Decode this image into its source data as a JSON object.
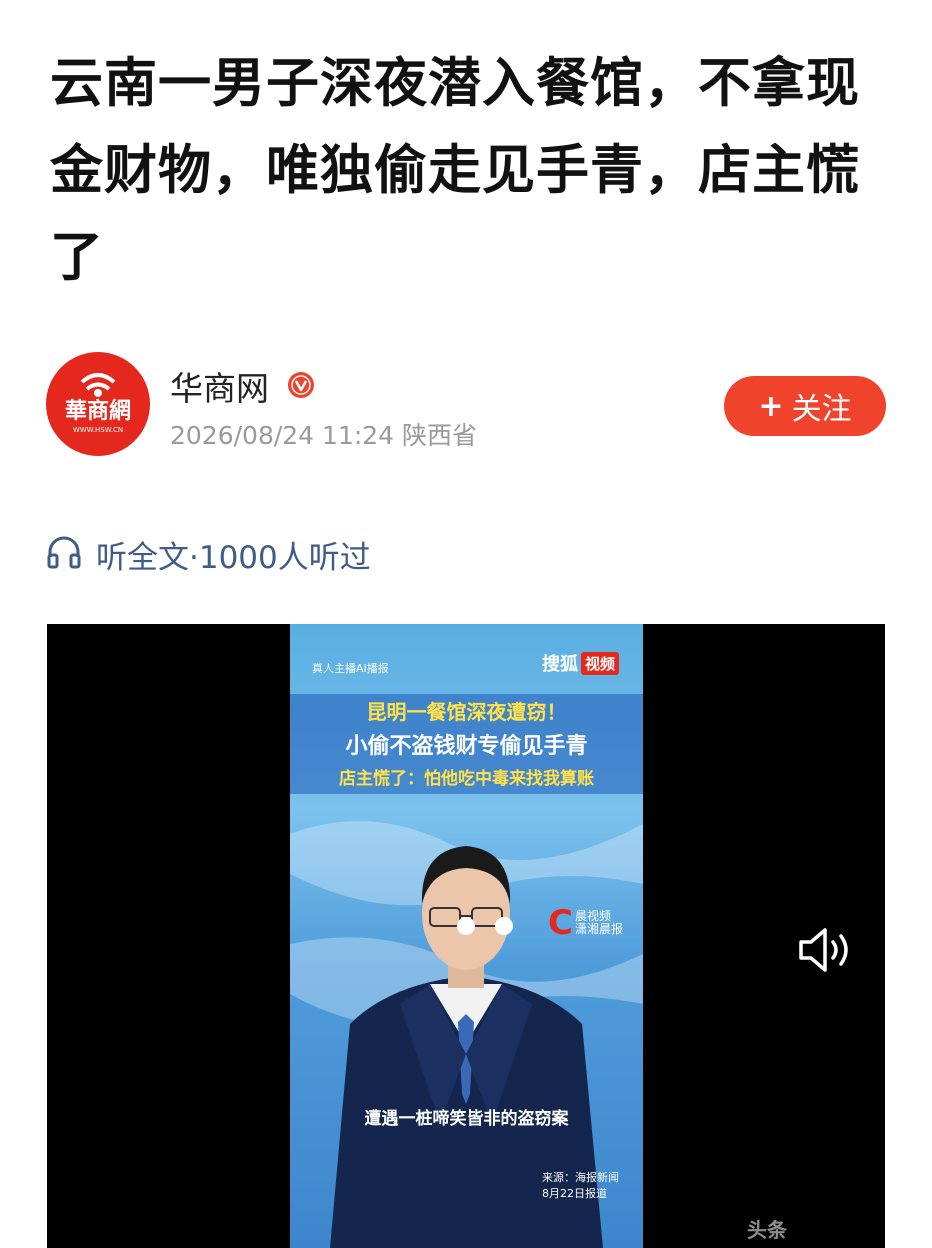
{
  "article": {
    "title": "云南一男子深夜潜入餐馆，不拿现金财物，唯独偷走见手青，店主慌了"
  },
  "author": {
    "name": "华商网",
    "avatar_text": "華商網",
    "avatar_url_text": "WWW.HSW.CN",
    "verified_icon": "verified-v-icon",
    "meta": "2026/08/24 11:24 陕西省",
    "follow_label": "关注",
    "follow_plus": "+"
  },
  "listen": {
    "icon": "headphones-icon",
    "label": "听全文·1000人听过"
  },
  "video": {
    "tag_left": "真人主播AI播报",
    "brand_main": "搜狐",
    "brand_badge": "视频",
    "headline_1": "昆明一餐馆深夜遭窃！",
    "headline_2": "小偷不盗钱财专偷见手青",
    "headline_3": "店主慌了：怕他吃中毒来找我算账",
    "channel_logo": "C",
    "channel_name": "晨视频",
    "channel_sub": "潇湘晨报",
    "subtitle": "遭遇一桩啼笑皆非的盗窃案",
    "source_line1": "来源：海报新闻",
    "source_line2": "8月22日报道",
    "volume_icon": "volume-icon",
    "watermark": "头条"
  },
  "colors": {
    "accent": "#f0432b",
    "link": "#3e5c86",
    "meta": "#9a9a9a",
    "brand_red": "#e4281d"
  }
}
